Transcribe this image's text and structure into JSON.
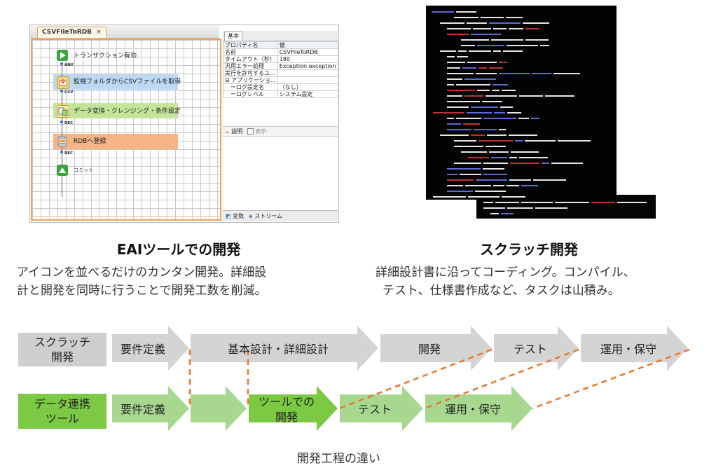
{
  "eai_tool": {
    "tab_title": "CSVFileToRDB",
    "tab_close": "×",
    "flow": [
      {
        "label": "トランザクション有効",
        "connector": "ANY"
      },
      {
        "label": "監視フォルダからCSVファイルを取得",
        "connector": "CSV"
      },
      {
        "label": "データ変換・クレンジング・条件設定",
        "connector": "REC"
      },
      {
        "label": "RDBへ登録",
        "connector": "REC"
      },
      {
        "label": "コミット",
        "connector": ""
      }
    ],
    "property_tab": "基本",
    "property_header": [
      "プロパティ名",
      "値"
    ],
    "properties": [
      [
        "名前",
        "CSVFileToRDB"
      ],
      [
        "タイムアウト（秒）",
        "180"
      ],
      [
        "汎用エラー処理",
        "Exception.exception"
      ],
      [
        "実行を許可するユ...",
        ""
      ],
      [
        "⊟ アプリケーショ...",
        ""
      ],
      [
        "ーログ設定名",
        "（なし）"
      ],
      [
        "ーログレベル",
        "システム設定"
      ]
    ],
    "description_label": "説明",
    "display_label": "表示",
    "bottom_tabs": [
      "変数",
      "ストリーム"
    ]
  },
  "code": {
    "colors": {
      "text": "#e6e6e6",
      "keyword": "#5b6bd6",
      "string": "#c03030",
      "accent": "#d0d040"
    }
  },
  "left_block": {
    "title": "EAIツールでの開発",
    "desc": [
      "アイコンを並べるだけのカンタン開発。詳細設",
      "計と開発を同時に行うことで開発工数を削減。"
    ]
  },
  "right_block": {
    "title": "スクラッチ開発",
    "desc": [
      "詳細設計書に沿ってコーディング。コンパイル、",
      "テスト、仕様書作成など、タスクは山積み。"
    ]
  },
  "scratch_row": {
    "label": [
      "スクラッチ",
      "開発"
    ],
    "steps": [
      "要件定義",
      "基本設計・詳細設計",
      "開発",
      "テスト",
      "運用・保守"
    ]
  },
  "eai_row": {
    "label": [
      "データ連携",
      "ツール"
    ],
    "steps": [
      "要件定義",
      "",
      "ツールでの\n開発",
      "テスト",
      "運用・保守"
    ]
  },
  "caption": "開発工程の違い",
  "colors": {
    "gray_arrow": "#d4d4d4",
    "gray_label": "#cfcfcf",
    "green_light": "#a8d890",
    "green_bright": "#7cc943",
    "green_label": "#7cc943",
    "dash": "#e8772e"
  }
}
